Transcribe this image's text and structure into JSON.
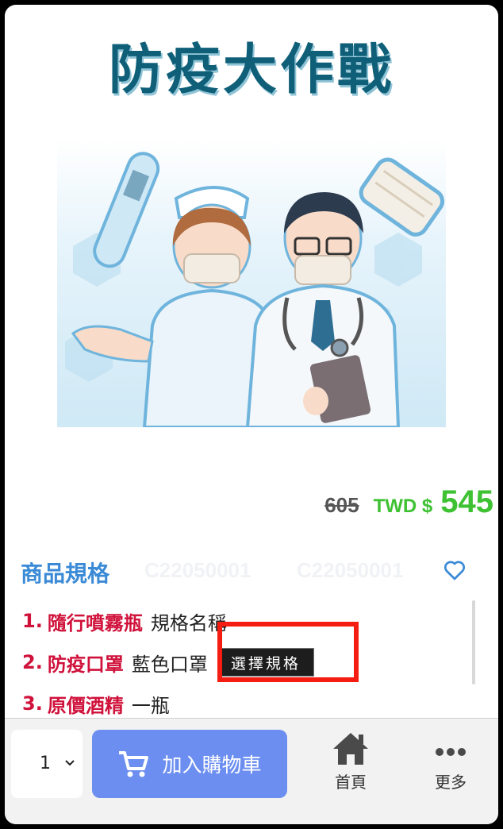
{
  "hero": {
    "title": "防疫大作戰"
  },
  "price": {
    "original": "605",
    "currency": "TWD $",
    "sale": "545"
  },
  "spec": {
    "title": "商品規格",
    "sku_codes": [
      "C22050001",
      "C22050001"
    ],
    "items": [
      {
        "num": "1.",
        "name": "隨行噴霧瓶",
        "value": "規格名稱"
      },
      {
        "num": "2.",
        "name": "防疫口罩",
        "value": "藍色口罩",
        "button": "選擇規格"
      },
      {
        "num": "3.",
        "name": "原價酒精",
        "value": "一瓶"
      }
    ]
  },
  "bottom_bar": {
    "quantity": "1",
    "add_to_cart": "加入購物車",
    "home": "首頁",
    "more": "更多"
  },
  "colors": {
    "accent_green": "#3ec132",
    "spec_blue": "#3a8ad6",
    "item_red": "#d0123b",
    "cart_button": "#6b8ef0",
    "highlight_red": "#f51d12"
  }
}
